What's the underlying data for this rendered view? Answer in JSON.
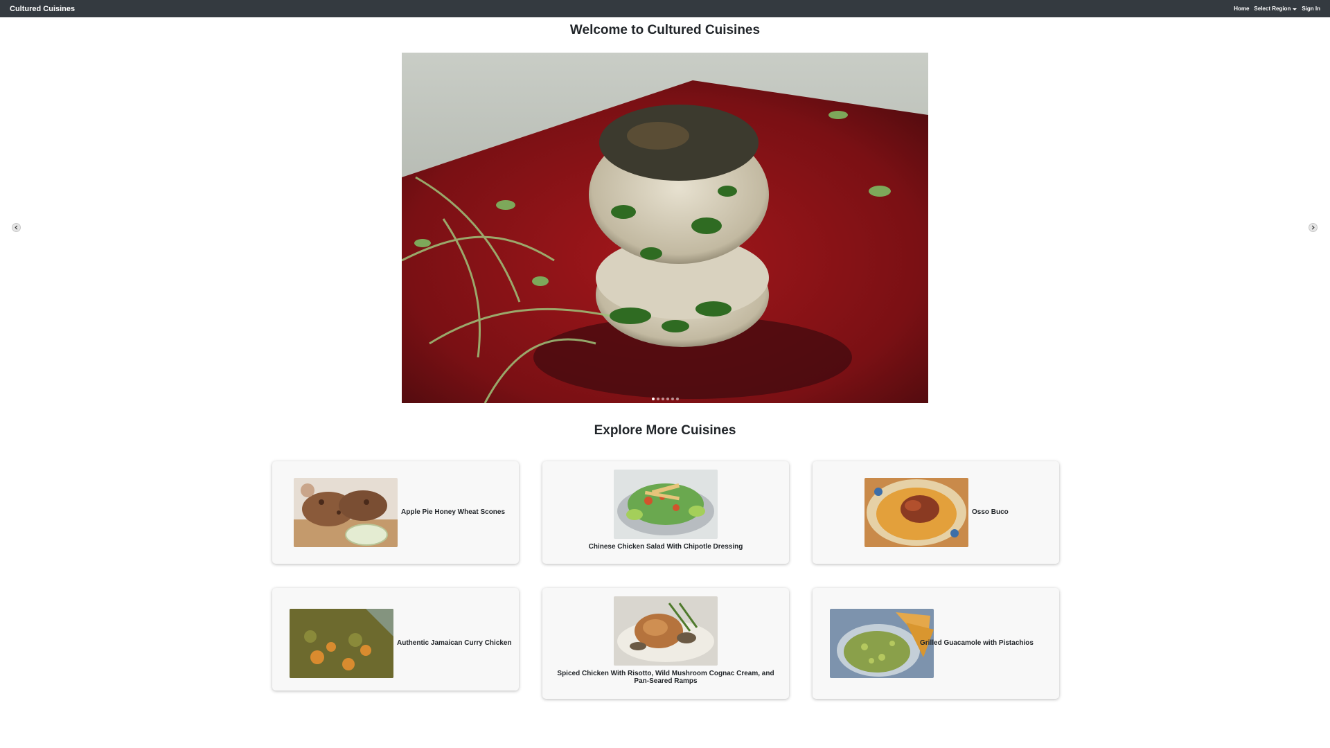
{
  "navbar": {
    "brand": "Cultured Cuisines",
    "links": {
      "home": "Home",
      "region": "Select Region",
      "signin": "Sign In"
    }
  },
  "hero": {
    "title": "Welcome to Cultured Cuisines",
    "slide_count": 6,
    "active_slide": 1
  },
  "explore": {
    "title": "Explore More Cuisines",
    "cards": [
      {
        "title": "Apple Pie Honey Wheat Scones"
      },
      {
        "title": "Chinese Chicken Salad With Chipotle Dressing"
      },
      {
        "title": "Osso Buco"
      },
      {
        "title": "Authentic Jamaican Curry Chicken"
      },
      {
        "title": "Spiced Chicken With Risotto, Wild Mushroom Cognac Cream, and Pan-Seared Ramps"
      },
      {
        "title": "Grilled Guacamole with Pistachios"
      }
    ]
  },
  "colors": {
    "navbar": "#343a40",
    "card_background": "#f8f8f8",
    "text": "#212529"
  }
}
